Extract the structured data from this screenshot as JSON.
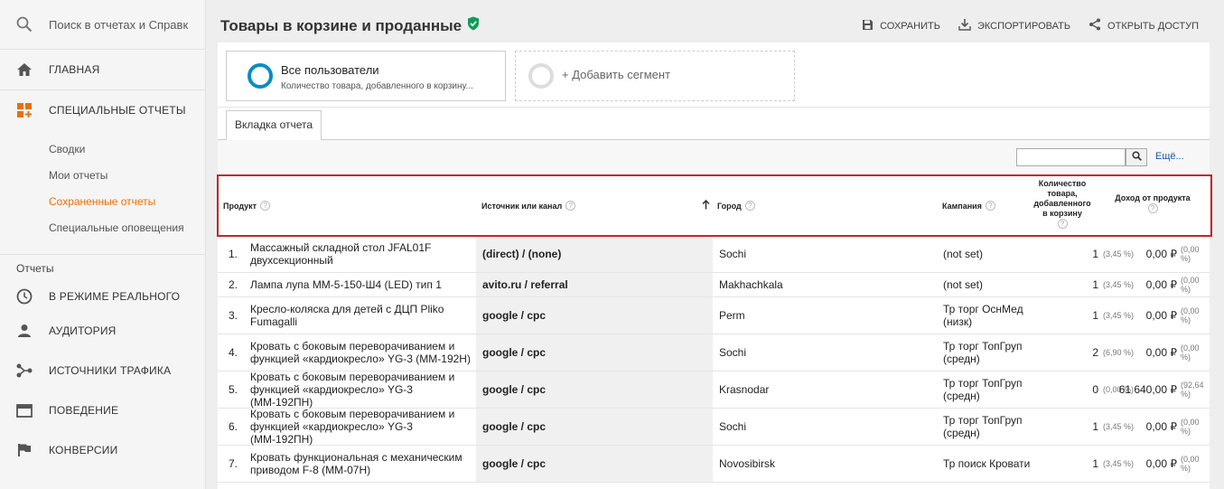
{
  "sidebar": {
    "search_placeholder": "Поиск в отчетах и Справк",
    "home": "ГЛАВНАЯ",
    "custom_reports": "СПЕЦИАЛЬНЫЕ ОТЧЕТЫ",
    "sub_items": [
      "Сводки",
      "Мои отчеты",
      "Сохраненные отчеты",
      "Специальные оповещения"
    ],
    "reports_label": "Отчеты",
    "realtime": "В РЕЖИМЕ РЕАЛЬНОГО",
    "audience": "АУДИТОРИЯ",
    "acquisition": "ИСТОЧНИКИ ТРАФИКА",
    "behavior": "ПОВЕДЕНИЕ",
    "conversions": "КОНВЕРСИИ"
  },
  "header": {
    "title": "Товары в корзине и проданные",
    "save": "СОХРАНИТЬ",
    "export": "ЭКСПОРТИРОВАТЬ",
    "share": "ОТКРЫТЬ ДОСТУП"
  },
  "segments": {
    "all_users": "Все пользователи",
    "all_users_sub": "Количество товара, добавленного в корзину...",
    "add_segment": "+ Добавить сегмент"
  },
  "tab_label": "Вкладка отчета",
  "toolbar": {
    "more": "Ещё..."
  },
  "table": {
    "columns": {
      "product": "Продукт",
      "source": "Источник или канал",
      "city": "Город",
      "campaign": "Кампания",
      "qty_line1": "Количество",
      "qty_line2": "товара,",
      "qty_line3": "добавленного",
      "qty_line4": "в корзину",
      "revenue": "Доход от продукта"
    },
    "rows": [
      {
        "n": "1.",
        "product": "Массажный складной стол JFAL01F двухсекционный",
        "source": "(direct) / (none)",
        "city": "Sochi",
        "campaign": "(not set)",
        "qty": "1",
        "qty_pct": "(3,45 %)",
        "rev": "0,00 ₽",
        "rev_pct": "(0,00 %)"
      },
      {
        "n": "2.",
        "product": "Лампа лупа ММ-5-150-Ш4 (LED) тип 1",
        "source": "avito.ru / referral",
        "city": "Makhachkala",
        "campaign": "(not set)",
        "qty": "1",
        "qty_pct": "(3,45 %)",
        "rev": "0,00 ₽",
        "rev_pct": "(0,00 %)"
      },
      {
        "n": "3.",
        "product": "Кресло-коляска для детей с ДЦП Pliko Fumagalli",
        "source": "google / cpc",
        "city": "Perm",
        "campaign": "Тр торг ОснМед (низк)",
        "qty": "1",
        "qty_pct": "(3,45 %)",
        "rev": "0,00 ₽",
        "rev_pct": "(0,00 %)"
      },
      {
        "n": "4.",
        "product": "Кровать с боковым переворачиванием и функцией «кардиокресло» YG-3 (ММ-192Н)",
        "source": "google / cpc",
        "city": "Sochi",
        "campaign": "Тр торг ТопГруп (средн)",
        "qty": "2",
        "qty_pct": "(6,90 %)",
        "rev": "0,00 ₽",
        "rev_pct": "(0,00 %)"
      },
      {
        "n": "5.",
        "product": "Кровать с боковым переворачиванием и функцией «кардиокресло» YG-3 (ММ-192ПН)",
        "source": "google / cpc",
        "city": "Krasnodar",
        "campaign": "Тр торг ТопГруп (средн)",
        "qty": "0",
        "qty_pct": "(0,00 %)",
        "rev": "61 640,00 ₽",
        "rev_pct": "(92,64 %)"
      },
      {
        "n": "6.",
        "product": "Кровать с боковым переворачиванием и функцией «кардиокресло» YG-3 (ММ-192ПН)",
        "source": "google / cpc",
        "city": "Sochi",
        "campaign": "Тр торг ТопГруп (средн)",
        "qty": "1",
        "qty_pct": "(3,45 %)",
        "rev": "0,00 ₽",
        "rev_pct": "(0,00 %)"
      },
      {
        "n": "7.",
        "product": "Кровать функциональная с механическим приводом F-8 (ММ-07Н)",
        "source": "google / cpc",
        "city": "Novosibirsk",
        "campaign": "Тр поиск Кровати",
        "qty": "1",
        "qty_pct": "(3,45 %)",
        "rev": "0,00 ₽",
        "rev_pct": "(0,00 %)"
      }
    ]
  }
}
